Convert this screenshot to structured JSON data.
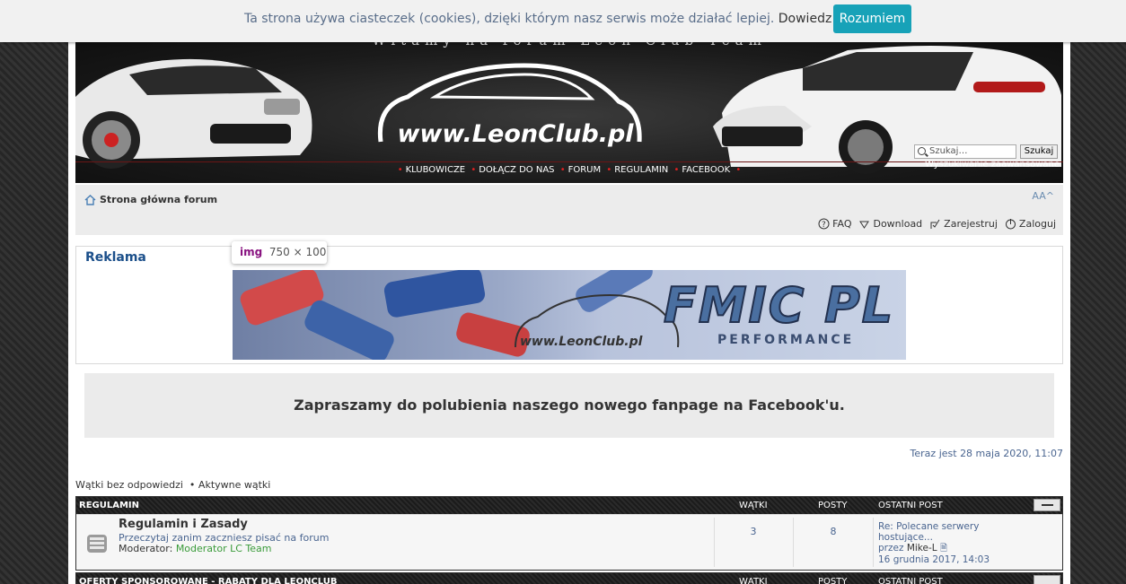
{
  "cookie_bar": {
    "message": "Ta strona używa ciasteczek (cookies), dzięki którym nasz serwis może działać lepiej.",
    "more_link": "Dowiedz się więcej",
    "accept_button": "Rozumiem"
  },
  "header": {
    "tagline": "Witamy na forum Leon Club Team",
    "logo_text": "www.LeonClub.pl",
    "nav": [
      "KLUBOWICZE",
      "DOŁĄCZ DO NAS",
      "FORUM",
      "REGULAMIN",
      "FACEBOOK"
    ],
    "search_placeholder": "Szukaj…",
    "search_button": "Szukaj",
    "advanced_search": "Wyszukiwanie zaawansowane"
  },
  "navbar": {
    "breadcrumb": "Strona główna forum",
    "font_size_toggle": "AA^",
    "links": [
      "FAQ",
      "Download",
      "Zarejestruj",
      "Zaloguj"
    ]
  },
  "ad": {
    "heading": "Reklama",
    "tooltip_tag": "img",
    "tooltip_size": "750 × 100",
    "banner_brand": "FMIC PL",
    "banner_sub": "PERFORMANCE",
    "banner_url": "www.LeonClub.pl"
  },
  "facebook_box": "Zapraszamy do polubienia naszego nowego fanpage na Facebook'u.",
  "current_time": "Teraz jest 28 maja 2020, 11:07",
  "quick_links": [
    "Wątki bez odpowiedzi",
    "Aktywne wątki"
  ],
  "forum_section": {
    "name": "REGULAMIN",
    "col_topics": "WĄTKI",
    "col_posts": "POSTY",
    "col_last": "OSTATNI POST",
    "rows": [
      {
        "title": "Regulamin i Zasady",
        "description": "Przeczytaj zanim zaczniesz pisać na forum",
        "moderator_label": "Moderator:",
        "moderator": "Moderator LC Team",
        "topics": "3",
        "posts": "8",
        "last_title": "Re: Polecane serwery hostujące...",
        "last_by": "przez",
        "last_user": "Mike-L",
        "last_date": "16 grudnia 2017, 14:03"
      }
    ]
  },
  "forum_section_2": {
    "name": "OFERTY SPONSOROWANE - RABATY DLA LEONCLUB",
    "col_topics": "WĄTKI",
    "col_posts": "POSTY",
    "col_last": "OSTATNI POST"
  },
  "colors": {
    "accent": "#17a2b8",
    "link": "#4a6590",
    "heading": "#1b4f8a",
    "moderator": "#3a9b3a",
    "nav_dot": "#e02020"
  }
}
